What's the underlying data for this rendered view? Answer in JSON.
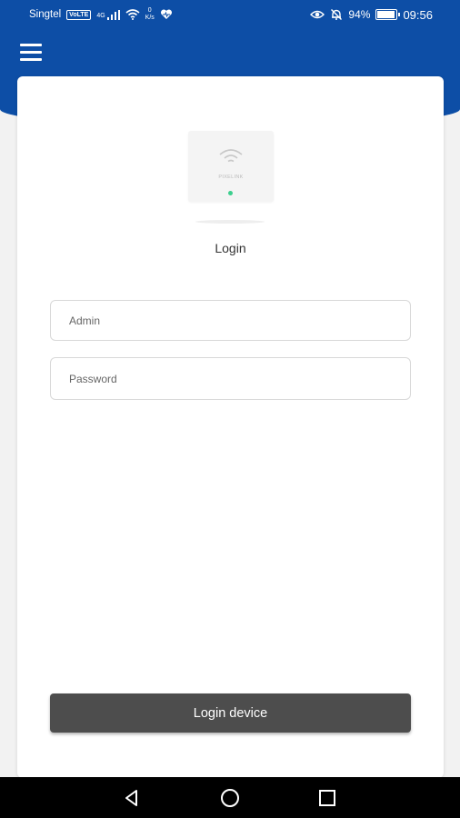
{
  "status_bar": {
    "carrier": "Singtel",
    "volte_badge": "VoLTE",
    "network_type": "4G",
    "speed_value": "0",
    "speed_unit": "K/s",
    "battery_percent": "94%",
    "battery_level": 0.94,
    "time": "09:56",
    "icons": [
      "signal-icon",
      "wifi-icon",
      "heart-health-icon",
      "eye-comfort-icon",
      "alarm-off-icon",
      "battery-icon"
    ]
  },
  "app_bar": {
    "menu_icon": "hamburger-menu-icon",
    "color": "#0d4ea6"
  },
  "device": {
    "brand_label": "PIXELINK",
    "led_color": "#3ccf8e"
  },
  "login": {
    "title": "Login",
    "username_placeholder": "Admin",
    "password_placeholder": "Password",
    "submit_label": "Login device",
    "button_color": "#4d4d4d"
  },
  "nav_bar": {
    "buttons": [
      "back-icon",
      "home-icon",
      "recent-apps-icon"
    ]
  }
}
